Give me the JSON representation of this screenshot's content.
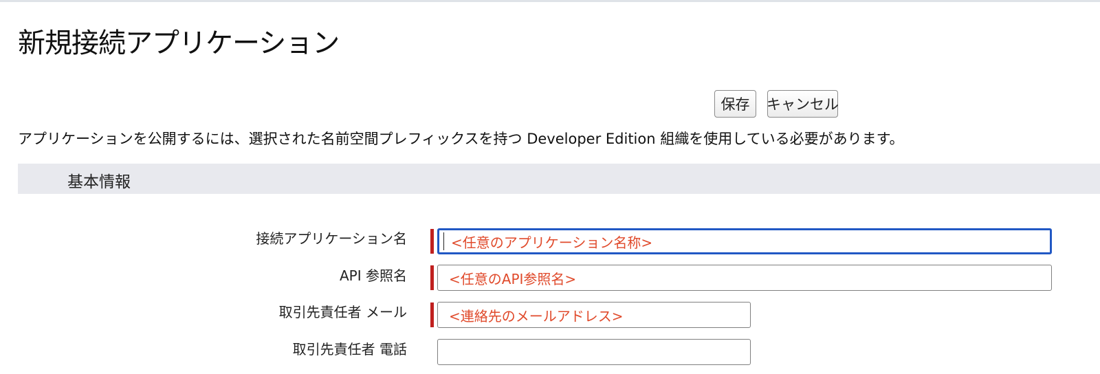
{
  "page": {
    "title": "新規接続アプリケーション",
    "notice": "アプリケーションを公開するには、選択された名前空間プレフィックスを持つ Developer Edition 組織を使用している必要があります。"
  },
  "toolbar": {
    "save_label": "保存",
    "cancel_label": "キャンセル"
  },
  "section": {
    "title": "基本情報"
  },
  "fields": [
    {
      "label": "接続アプリケーション名",
      "value": "<任意のアプリケーション名称>",
      "required": true,
      "focused": true
    },
    {
      "label": "API 参照名",
      "value": "<任意のAPI参照名>",
      "required": true,
      "focused": false
    },
    {
      "label": "取引先責任者 メール",
      "value": "<連絡先のメールアドレス>",
      "required": true,
      "focused": false
    },
    {
      "label": "取引先責任者 電話",
      "value": "",
      "required": false,
      "focused": false
    }
  ],
  "colors": {
    "required_marker": "#c0201f",
    "focus_border": "#2158c4",
    "annotation_text": "#e04a2b",
    "section_background": "#e8e9ee"
  }
}
